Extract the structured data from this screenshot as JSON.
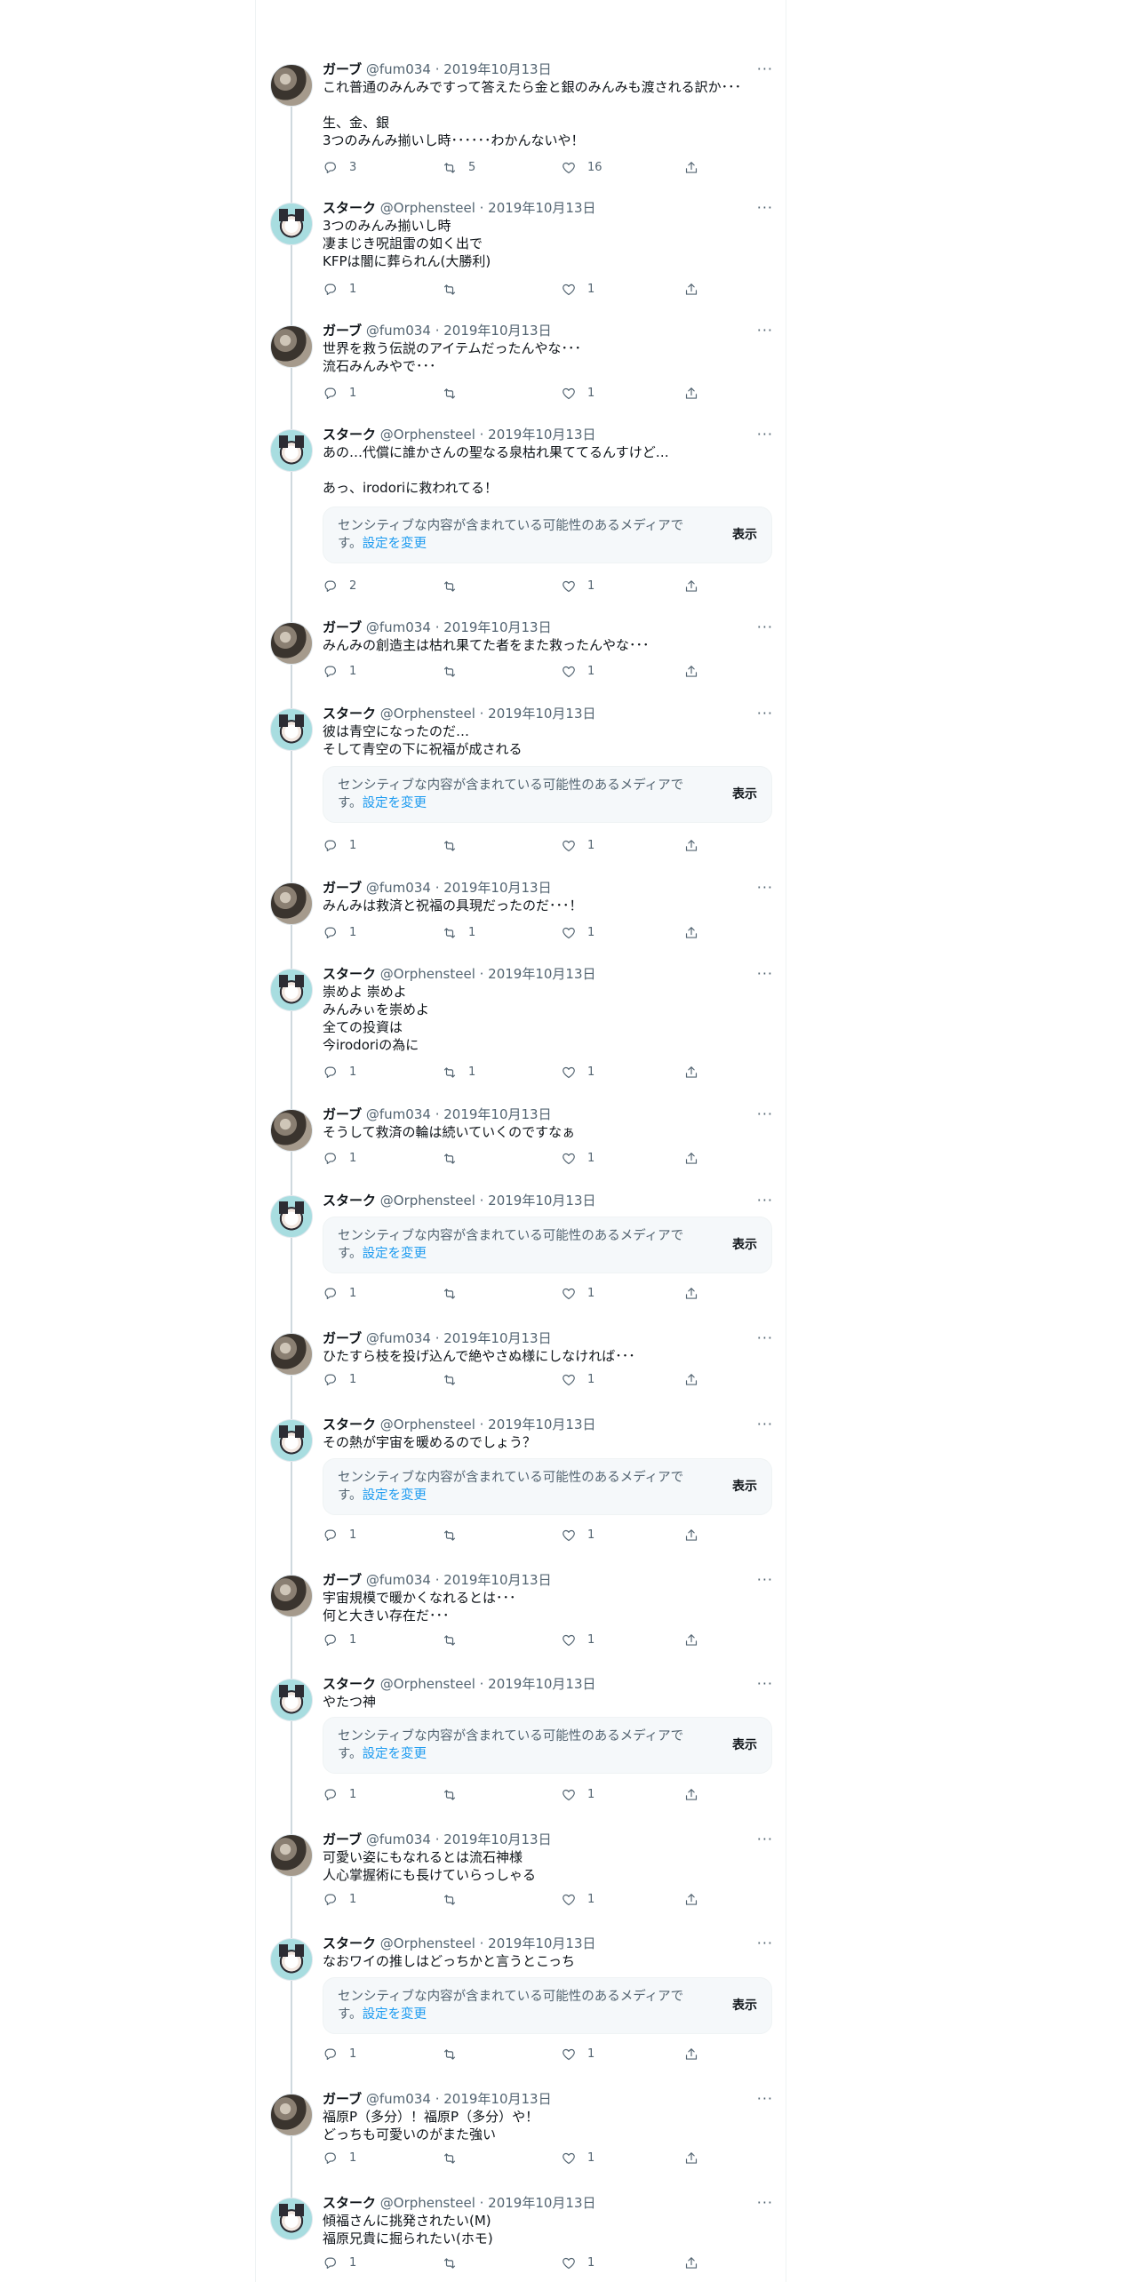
{
  "labels": {
    "sensitive_text": "センシティブな内容が含まれている可能性のあるメディアです。",
    "sensitive_link": "設定を変更",
    "show_button": "表示"
  },
  "users": {
    "gabu": {
      "name": "ガーブ",
      "handle": "@fum034"
    },
    "stark": {
      "name": "スターク",
      "handle": "@Orphensteel"
    }
  },
  "date": "2019年10月13日",
  "tweets": [
    {
      "user": "gabu",
      "text": "これ普通のみんみですって答えたら金と銀のみんみも渡される訳か･･･\n\n生、金、銀\n3つのみんみ揃いし時･･････わかんないや！",
      "replies": "3",
      "retweets": "5",
      "likes": "16",
      "sensitive": false
    },
    {
      "user": "stark",
      "text": "3つのみんみ揃いし時\n凄まじき呪詛雷の如く出で\nKFPは闇に葬られん(大勝利)",
      "replies": "1",
      "retweets": "",
      "likes": "1",
      "sensitive": false
    },
    {
      "user": "gabu",
      "text": "世界を救う伝説のアイテムだったんやな･･･\n流石みんみやで･･･",
      "replies": "1",
      "retweets": "",
      "likes": "1",
      "sensitive": false
    },
    {
      "user": "stark",
      "text": "あの…代償に誰かさんの聖なる泉枯れ果ててるんすけど…\n\nあっ、irodoriに救われてる！",
      "replies": "2",
      "retweets": "",
      "likes": "1",
      "sensitive": true
    },
    {
      "user": "gabu",
      "text": "みんみの創造主は枯れ果てた者をまた救ったんやな･･･",
      "replies": "1",
      "retweets": "",
      "likes": "1",
      "sensitive": false
    },
    {
      "user": "stark",
      "text": "彼は青空になったのだ…\nそして青空の下に祝福が成される",
      "replies": "1",
      "retweets": "",
      "likes": "1",
      "sensitive": true
    },
    {
      "user": "gabu",
      "text": "みんみは救済と祝福の具現だったのだ･･･！",
      "replies": "1",
      "retweets": "1",
      "likes": "1",
      "sensitive": false
    },
    {
      "user": "stark",
      "text": "崇めよ 崇めよ\nみんみぃを崇めよ\n全ての投資は\n今irodoriの為に",
      "replies": "1",
      "retweets": "1",
      "likes": "1",
      "sensitive": false
    },
    {
      "user": "gabu",
      "text": "そうして救済の輪は続いていくのですなぁ",
      "replies": "1",
      "retweets": "",
      "likes": "1",
      "sensitive": false
    },
    {
      "user": "stark",
      "text": "",
      "replies": "1",
      "retweets": "",
      "likes": "1",
      "sensitive": true
    },
    {
      "user": "gabu",
      "text": "ひたすら枝を投げ込んで絶やさぬ様にしなければ･･･",
      "replies": "1",
      "retweets": "",
      "likes": "1",
      "sensitive": false
    },
    {
      "user": "stark",
      "text": "その熱が宇宙を暖めるのでしょう？",
      "replies": "1",
      "retweets": "",
      "likes": "1",
      "sensitive": true
    },
    {
      "user": "gabu",
      "text": "宇宙規模で暖かくなれるとは･･･\n何と大きい存在だ･･･",
      "replies": "1",
      "retweets": "",
      "likes": "1",
      "sensitive": false
    },
    {
      "user": "stark",
      "text": "やたつ神",
      "replies": "1",
      "retweets": "",
      "likes": "1",
      "sensitive": true
    },
    {
      "user": "gabu",
      "text": "可愛い姿にもなれるとは流石神様\n人心掌握術にも長けていらっしゃる",
      "replies": "1",
      "retweets": "",
      "likes": "1",
      "sensitive": false
    },
    {
      "user": "stark",
      "text": "なおワイの推しはどっちかと言うとこっち",
      "replies": "1",
      "retweets": "",
      "likes": "1",
      "sensitive": true
    },
    {
      "user": "gabu",
      "text": "福原P（多分）！福原P（多分）や！\nどっちも可愛いのがまた強い",
      "replies": "1",
      "retweets": "",
      "likes": "1",
      "sensitive": false
    },
    {
      "user": "stark",
      "text": "傾福さんに挑発されたい(M)\n福原兄貴に掘られたい(ホモ)",
      "replies": "1",
      "retweets": "",
      "likes": "1",
      "sensitive": false
    }
  ]
}
